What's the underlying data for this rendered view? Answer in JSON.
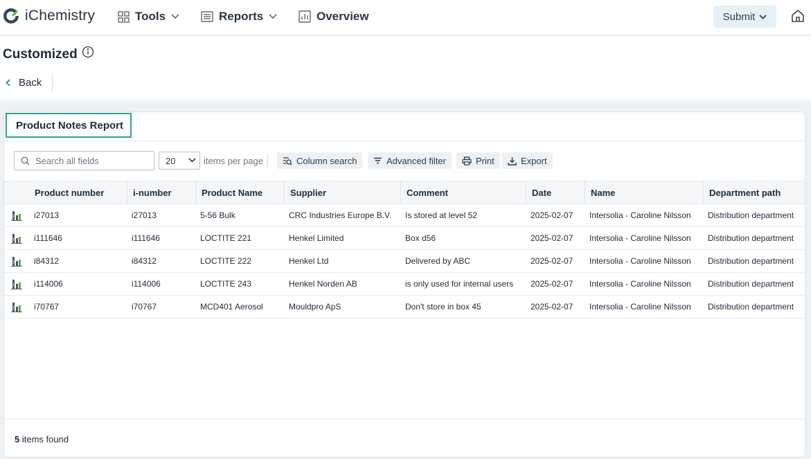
{
  "header": {
    "brand": "iChemistry",
    "nav": [
      {
        "label": "Tools",
        "icon": "grid-icon"
      },
      {
        "label": "Reports",
        "icon": "list-report-icon"
      },
      {
        "label": "Overview",
        "icon": "bar-chart-icon"
      }
    ],
    "submit_label": "Submit"
  },
  "page": {
    "title": "Customized",
    "back_label": "Back"
  },
  "report": {
    "title": "Product Notes Report",
    "search_placeholder": "Search all fields",
    "per_page_value": "20",
    "per_page_label": "items per page",
    "buttons": {
      "column_search": "Column search",
      "advanced_filter": "Advanced filter",
      "print": "Print",
      "export": "Export"
    },
    "columns": [
      "Product number",
      "i-number",
      "Product Name",
      "Supplier",
      "Comment",
      "Date",
      "Name",
      "Department path"
    ],
    "rows": [
      [
        "i27013",
        "i27013",
        "5-56 Bulk",
        "CRC Industries Europe B.V.",
        "Is stored at level 52",
        "2025-02-07",
        "Intersolia - Caroline Nilsson",
        "Distribution department"
      ],
      [
        "i111646",
        "i111646",
        "LOCTITE 221",
        "Henkel Limited",
        "Box d56",
        "2025-02-07",
        "Intersolia - Caroline Nilsson",
        "Distribution department"
      ],
      [
        "i84312",
        "i84312",
        "LOCTITE 222",
        "Henkel Ltd",
        "Delivered by ABC",
        "2025-02-07",
        "Intersolia - Caroline Nilsson",
        "Distribution department"
      ],
      [
        "i114006",
        "i114006",
        "LOCTITE 243",
        "Henkel Norden AB",
        "is only used for internal users",
        "2025-02-07",
        "Intersolia - Caroline Nilsson",
        "Distribution department"
      ],
      [
        "i70767",
        "i70767",
        "MCD401 Aerosol",
        "Mouldpro ApS",
        "Don't store in box 45",
        "2025-02-07",
        "Intersolia - Caroline Nilsson",
        "Distribution department"
      ]
    ],
    "count": "5",
    "count_label": "items found"
  },
  "colors": {
    "accent": "#2aa58a",
    "submit_bg": "#e6f1f6",
    "workspace_bg": "#eef1f4"
  }
}
